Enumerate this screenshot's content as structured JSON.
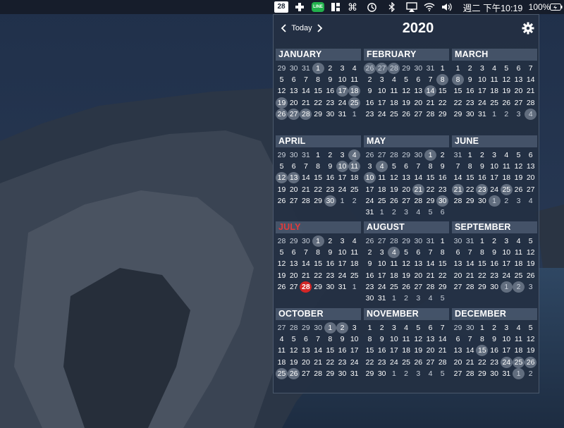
{
  "menubar": {
    "calendar_icon_day": "28",
    "plus_icon": "medical-plus-icon",
    "line_app_label": "LINE",
    "clock": "週二 下午10:19",
    "battery_percent": "100%"
  },
  "popover": {
    "today_label": "Today",
    "year": "2020",
    "today_color": "#d32626",
    "busy_color": "#8f98a6"
  },
  "months": [
    {
      "name": "JANUARY",
      "current": false,
      "weeks": [
        [
          "29",
          "30",
          "31",
          "1",
          "2",
          "3",
          "4"
        ],
        [
          "5",
          "6",
          "7",
          "8",
          "9",
          "10",
          "11"
        ],
        [
          "12",
          "13",
          "14",
          "15",
          "16",
          "17",
          "18"
        ],
        [
          "19",
          "20",
          "21",
          "22",
          "23",
          "24",
          "25"
        ],
        [
          "26",
          "27",
          "28",
          "29",
          "30",
          "31",
          "1"
        ]
      ],
      "lead": 3,
      "busy": [
        "1",
        "17",
        "18",
        "19",
        "25",
        "26",
        "27",
        "28"
      ]
    },
    {
      "name": "FEBRUARY",
      "current": false,
      "weeks": [
        [
          "26",
          "27",
          "28",
          "29",
          "30",
          "31",
          "1"
        ],
        [
          "2",
          "3",
          "4",
          "5",
          "6",
          "7",
          "8"
        ],
        [
          "9",
          "10",
          "11",
          "12",
          "13",
          "14",
          "15"
        ],
        [
          "16",
          "17",
          "18",
          "19",
          "20",
          "21",
          "22"
        ],
        [
          "23",
          "24",
          "25",
          "26",
          "27",
          "28",
          "29"
        ]
      ],
      "lead": 6,
      "busy": [
        "pre:26",
        "pre:27",
        "pre:28",
        "8",
        "14"
      ]
    },
    {
      "name": "MARCH",
      "current": false,
      "weeks": [
        [
          "1",
          "2",
          "3",
          "4",
          "5",
          "6",
          "7"
        ],
        [
          "8",
          "9",
          "10",
          "11",
          "12",
          "13",
          "14"
        ],
        [
          "15",
          "16",
          "17",
          "18",
          "19",
          "20",
          "21"
        ],
        [
          "22",
          "23",
          "24",
          "25",
          "26",
          "27",
          "28"
        ],
        [
          "29",
          "30",
          "31",
          "1",
          "2",
          "3",
          "4"
        ]
      ],
      "lead": 0,
      "busy": [
        "8",
        "post:4"
      ]
    },
    {
      "name": "APRIL",
      "current": false,
      "weeks": [
        [
          "29",
          "30",
          "31",
          "1",
          "2",
          "3",
          "4"
        ],
        [
          "5",
          "6",
          "7",
          "8",
          "9",
          "10",
          "11"
        ],
        [
          "12",
          "13",
          "14",
          "15",
          "16",
          "17",
          "18"
        ],
        [
          "19",
          "20",
          "21",
          "22",
          "23",
          "24",
          "25"
        ],
        [
          "26",
          "27",
          "28",
          "29",
          "30",
          "1",
          "2"
        ]
      ],
      "lead": 3,
      "busy": [
        "4",
        "10",
        "11",
        "12",
        "13",
        "30"
      ]
    },
    {
      "name": "MAY",
      "current": false,
      "weeks": [
        [
          "26",
          "27",
          "28",
          "29",
          "30",
          "1",
          "2"
        ],
        [
          "3",
          "4",
          "5",
          "6",
          "7",
          "8",
          "9"
        ],
        [
          "10",
          "11",
          "12",
          "13",
          "14",
          "15",
          "16"
        ],
        [
          "17",
          "18",
          "19",
          "20",
          "21",
          "22",
          "23"
        ],
        [
          "24",
          "25",
          "26",
          "27",
          "28",
          "29",
          "30"
        ],
        [
          "31",
          "1",
          "2",
          "3",
          "4",
          "5",
          "6"
        ]
      ],
      "lead": 5,
      "busy": [
        "1",
        "4",
        "10",
        "21",
        "30"
      ]
    },
    {
      "name": "JUNE",
      "current": false,
      "weeks": [
        [
          "31",
          "1",
          "2",
          "3",
          "4",
          "5",
          "6"
        ],
        [
          "7",
          "8",
          "9",
          "10",
          "11",
          "12",
          "13"
        ],
        [
          "14",
          "15",
          "16",
          "17",
          "18",
          "19",
          "20"
        ],
        [
          "21",
          "22",
          "23",
          "24",
          "25",
          "26",
          "27"
        ],
        [
          "28",
          "29",
          "30",
          "1",
          "2",
          "3",
          "4"
        ]
      ],
      "lead": 1,
      "busy": [
        "21",
        "23",
        "25",
        "post:1"
      ]
    },
    {
      "name": "JULY",
      "current": true,
      "weeks": [
        [
          "28",
          "29",
          "30",
          "1",
          "2",
          "3",
          "4"
        ],
        [
          "5",
          "6",
          "7",
          "8",
          "9",
          "10",
          "11"
        ],
        [
          "12",
          "13",
          "14",
          "15",
          "16",
          "17",
          "18"
        ],
        [
          "19",
          "20",
          "21",
          "22",
          "23",
          "24",
          "25"
        ],
        [
          "26",
          "27",
          "28",
          "29",
          "30",
          "31",
          "1"
        ]
      ],
      "lead": 3,
      "busy": [
        "1"
      ],
      "today": "28"
    },
    {
      "name": "AUGUST",
      "current": false,
      "weeks": [
        [
          "26",
          "27",
          "28",
          "29",
          "30",
          "31",
          "1"
        ],
        [
          "2",
          "3",
          "4",
          "5",
          "6",
          "7",
          "8"
        ],
        [
          "9",
          "10",
          "11",
          "12",
          "13",
          "14",
          "15"
        ],
        [
          "16",
          "17",
          "18",
          "19",
          "20",
          "21",
          "22"
        ],
        [
          "23",
          "24",
          "25",
          "26",
          "27",
          "28",
          "29"
        ],
        [
          "30",
          "31",
          "1",
          "2",
          "3",
          "4",
          "5"
        ]
      ],
      "lead": 6,
      "busy": [
        "4"
      ]
    },
    {
      "name": "SEPTEMBER",
      "current": false,
      "weeks": [
        [
          "30",
          "31",
          "1",
          "2",
          "3",
          "4",
          "5"
        ],
        [
          "6",
          "7",
          "8",
          "9",
          "10",
          "11",
          "12"
        ],
        [
          "13",
          "14",
          "15",
          "16",
          "17",
          "18",
          "19"
        ],
        [
          "20",
          "21",
          "22",
          "23",
          "24",
          "25",
          "26"
        ],
        [
          "27",
          "28",
          "29",
          "30",
          "1",
          "2",
          "3"
        ]
      ],
      "lead": 2,
      "busy": [
        "post:1",
        "post:2"
      ]
    },
    {
      "name": "OCTOBER",
      "current": false,
      "weeks": [
        [
          "27",
          "28",
          "29",
          "30",
          "1",
          "2",
          "3"
        ],
        [
          "4",
          "5",
          "6",
          "7",
          "8",
          "9",
          "10"
        ],
        [
          "11",
          "12",
          "13",
          "14",
          "15",
          "16",
          "17"
        ],
        [
          "18",
          "19",
          "20",
          "21",
          "22",
          "23",
          "24"
        ],
        [
          "25",
          "26",
          "27",
          "28",
          "29",
          "30",
          "31"
        ]
      ],
      "lead": 4,
      "busy": [
        "1",
        "2",
        "25",
        "26"
      ]
    },
    {
      "name": "NOVEMBER",
      "current": false,
      "weeks": [
        [
          "1",
          "2",
          "3",
          "4",
          "5",
          "6",
          "7"
        ],
        [
          "8",
          "9",
          "10",
          "11",
          "12",
          "13",
          "14"
        ],
        [
          "15",
          "16",
          "17",
          "18",
          "19",
          "20",
          "21"
        ],
        [
          "22",
          "23",
          "24",
          "25",
          "26",
          "27",
          "28"
        ],
        [
          "29",
          "30",
          "1",
          "2",
          "3",
          "4",
          "5"
        ]
      ],
      "lead": 0,
      "busy": []
    },
    {
      "name": "DECEMBER",
      "current": false,
      "weeks": [
        [
          "29",
          "30",
          "1",
          "2",
          "3",
          "4",
          "5"
        ],
        [
          "6",
          "7",
          "8",
          "9",
          "10",
          "11",
          "12"
        ],
        [
          "13",
          "14",
          "15",
          "16",
          "17",
          "18",
          "19"
        ],
        [
          "20",
          "21",
          "22",
          "23",
          "24",
          "25",
          "26"
        ],
        [
          "27",
          "28",
          "29",
          "30",
          "31",
          "1",
          "2"
        ]
      ],
      "lead": 2,
      "busy": [
        "15",
        "24",
        "25",
        "26",
        "post:1"
      ]
    }
  ]
}
